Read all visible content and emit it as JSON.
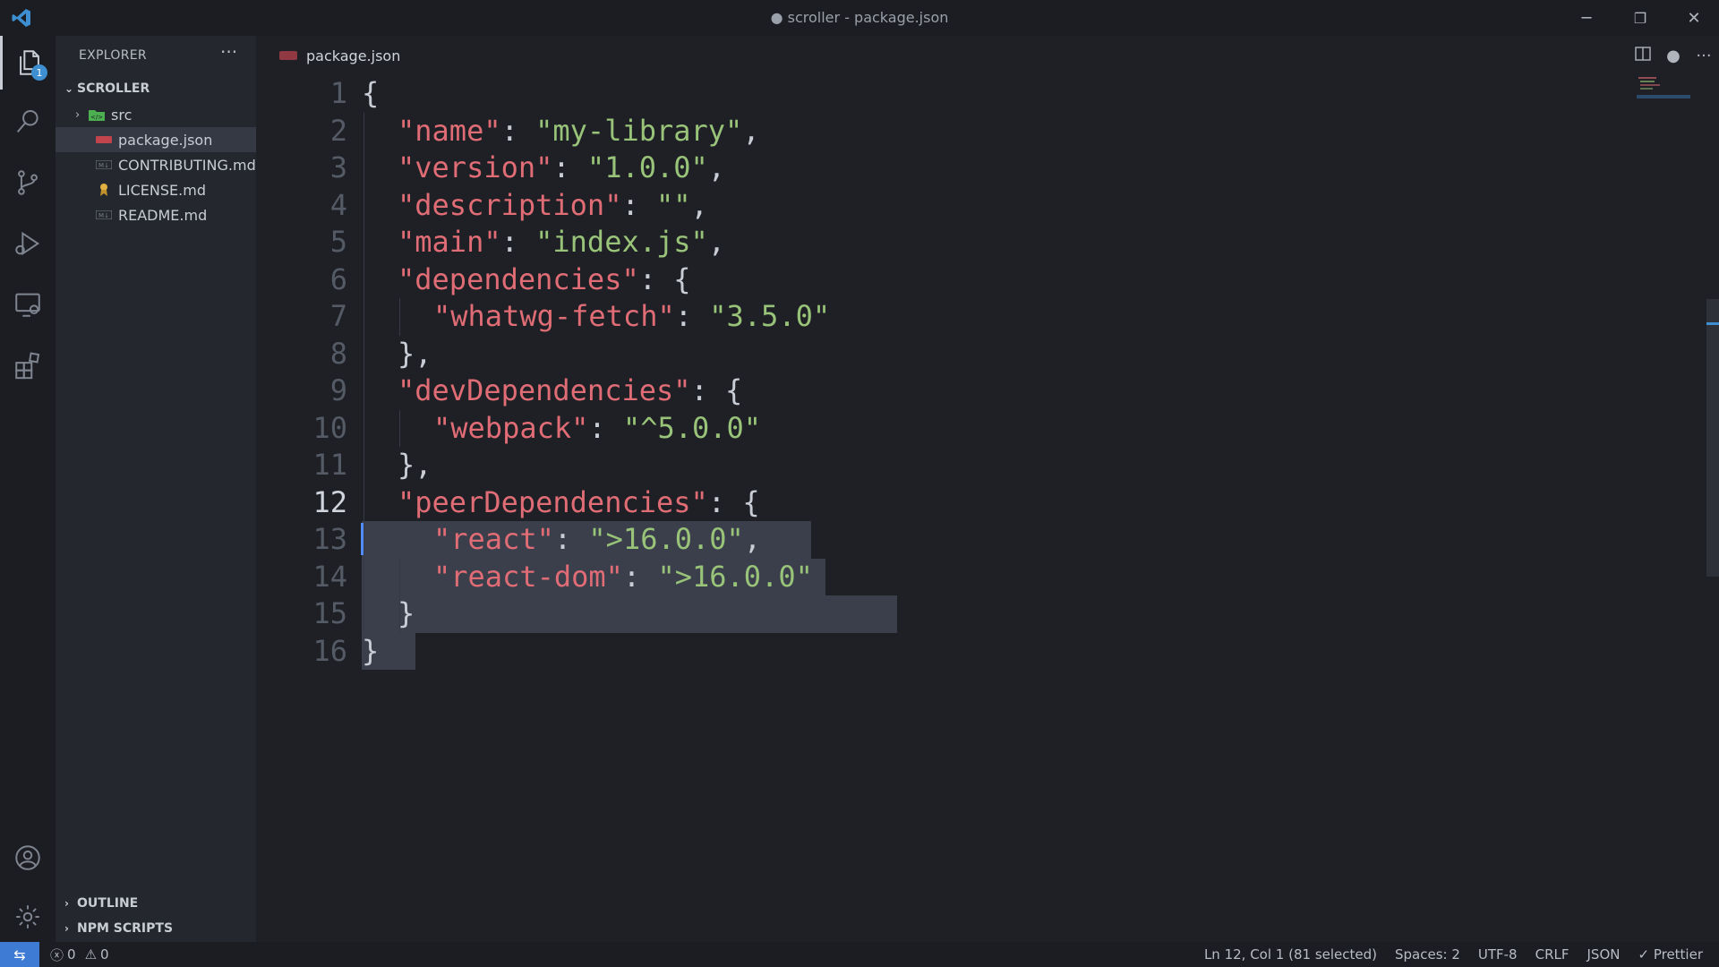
{
  "window": {
    "title": "● scroller - package.json",
    "minimize": "─",
    "restore": "❐",
    "close": "✕"
  },
  "activity": {
    "explorer_badge": "1"
  },
  "sidebar": {
    "title": "EXPLORER",
    "more": "···",
    "folder": "SCROLLER",
    "items": [
      {
        "label": "src",
        "icon": "folder-src-icon",
        "color": "#4caf50"
      },
      {
        "label": "package.json",
        "icon": "npm-icon",
        "color": "#c2454e"
      },
      {
        "label": "CONTRIBUTING.md",
        "icon": "markdown-icon",
        "color": "#7a7f8a"
      },
      {
        "label": "LICENSE.md",
        "icon": "license-icon",
        "color": "#e0b040"
      },
      {
        "label": "README.md",
        "icon": "markdown-icon",
        "color": "#7a7f8a"
      }
    ],
    "outline": "OUTLINE",
    "npm_scripts": "NPM SCRIPTS"
  },
  "editor": {
    "tab_label": "package.json",
    "actions": {
      "split": "split-editor-icon",
      "dirty": "●",
      "more": "···"
    },
    "lines": [
      {
        "n": "1",
        "t": "{"
      },
      {
        "n": "2",
        "k": "\"name\"",
        "v": "\"my-library\"",
        "end": ","
      },
      {
        "n": "3",
        "k": "\"version\"",
        "v": "\"1.0.0\"",
        "end": ","
      },
      {
        "n": "4",
        "k": "\"description\"",
        "v": "\"\"",
        "end": ","
      },
      {
        "n": "5",
        "k": "\"main\"",
        "v": "\"index.js\"",
        "end": ","
      },
      {
        "n": "6",
        "k": "\"dependencies\"",
        "open": "{"
      },
      {
        "n": "7",
        "k": "\"whatwg-fetch\"",
        "v": "\"3.5.0\""
      },
      {
        "n": "8",
        "t": "},"
      },
      {
        "n": "9",
        "k": "\"devDependencies\"",
        "open": "{"
      },
      {
        "n": "10",
        "k": "\"webpack\"",
        "v": "\"^5.0.0\""
      },
      {
        "n": "11",
        "t": "},"
      },
      {
        "n": "12",
        "k": "\"peerDependencies\"",
        "open": "{"
      },
      {
        "n": "13",
        "k": "\"react\"",
        "v": "\">16.0.0\"",
        "end": ","
      },
      {
        "n": "14",
        "k": "\"react-dom\"",
        "v": "\">16.0.0\""
      },
      {
        "n": "15",
        "t": "}"
      },
      {
        "n": "16",
        "t": "}"
      }
    ],
    "current_line": 12
  },
  "status": {
    "remote": "⇆",
    "errors": "0",
    "warnings": "0",
    "position": "Ln 12, Col 1 (81 selected)",
    "spaces": "Spaces: 2",
    "encoding": "UTF-8",
    "eol": "CRLF",
    "language": "JSON",
    "formatter": "✓ Prettier"
  },
  "colors": {
    "key": "#e06c75",
    "string": "#98c379",
    "accent": "#3d7bd4"
  }
}
